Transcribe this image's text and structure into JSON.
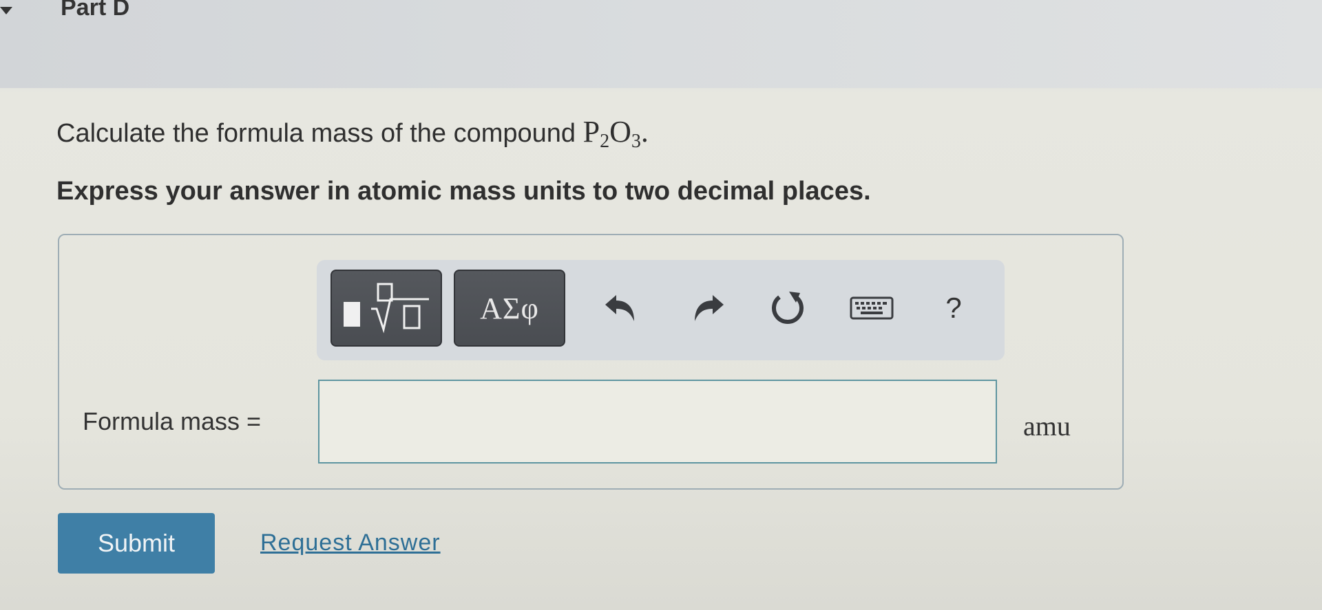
{
  "header": {
    "part_title": "Part D"
  },
  "question": {
    "prompt": "Calculate the formula mass of the compound ",
    "compound": {
      "element1": "P",
      "sub1": "2",
      "element2": "O",
      "sub2": "3",
      "period": "."
    },
    "instruction": "Express your answer in atomic mass units to two decimal places."
  },
  "toolbar": {
    "greek_label": "ΑΣφ",
    "help_label": "?",
    "icons": [
      "templates-icon",
      "undo-icon",
      "redo-icon",
      "reset-icon",
      "keyboard-icon",
      "help-icon"
    ]
  },
  "answer": {
    "label": "Formula mass =",
    "value": "",
    "unit": "amu"
  },
  "actions": {
    "submit_label": "Submit",
    "request_label": "Request Answer"
  },
  "colors": {
    "submit_bg": "#3f7fa6",
    "link": "#2e6f96",
    "toolbar_button": "#4a4d52",
    "input_border": "#5e95a0"
  }
}
